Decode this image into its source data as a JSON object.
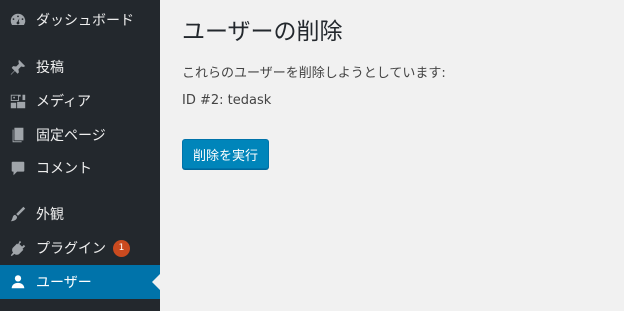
{
  "sidebar": {
    "items": [
      {
        "label": "ダッシュボード",
        "icon": "dashboard-icon"
      },
      {
        "label": "投稿",
        "icon": "pin-icon"
      },
      {
        "label": "メディア",
        "icon": "media-icon"
      },
      {
        "label": "固定ページ",
        "icon": "page-icon"
      },
      {
        "label": "コメント",
        "icon": "comment-icon"
      },
      {
        "label": "外観",
        "icon": "brush-icon"
      },
      {
        "label": "プラグイン",
        "icon": "plugin-icon",
        "badge": "1"
      },
      {
        "label": "ユーザー",
        "icon": "user-icon",
        "current": true
      }
    ]
  },
  "main": {
    "title": "ユーザーの削除",
    "description": "これらのユーザーを削除しようとしています:",
    "user_entry": "ID #2: tedask",
    "confirm_button": "削除を実行"
  },
  "colors": {
    "sidebar_bg": "#23282d",
    "current_bg": "#0073aa",
    "button_bg": "#0085ba",
    "badge_bg": "#ca4a1f",
    "page_bg": "#f1f1f1"
  }
}
